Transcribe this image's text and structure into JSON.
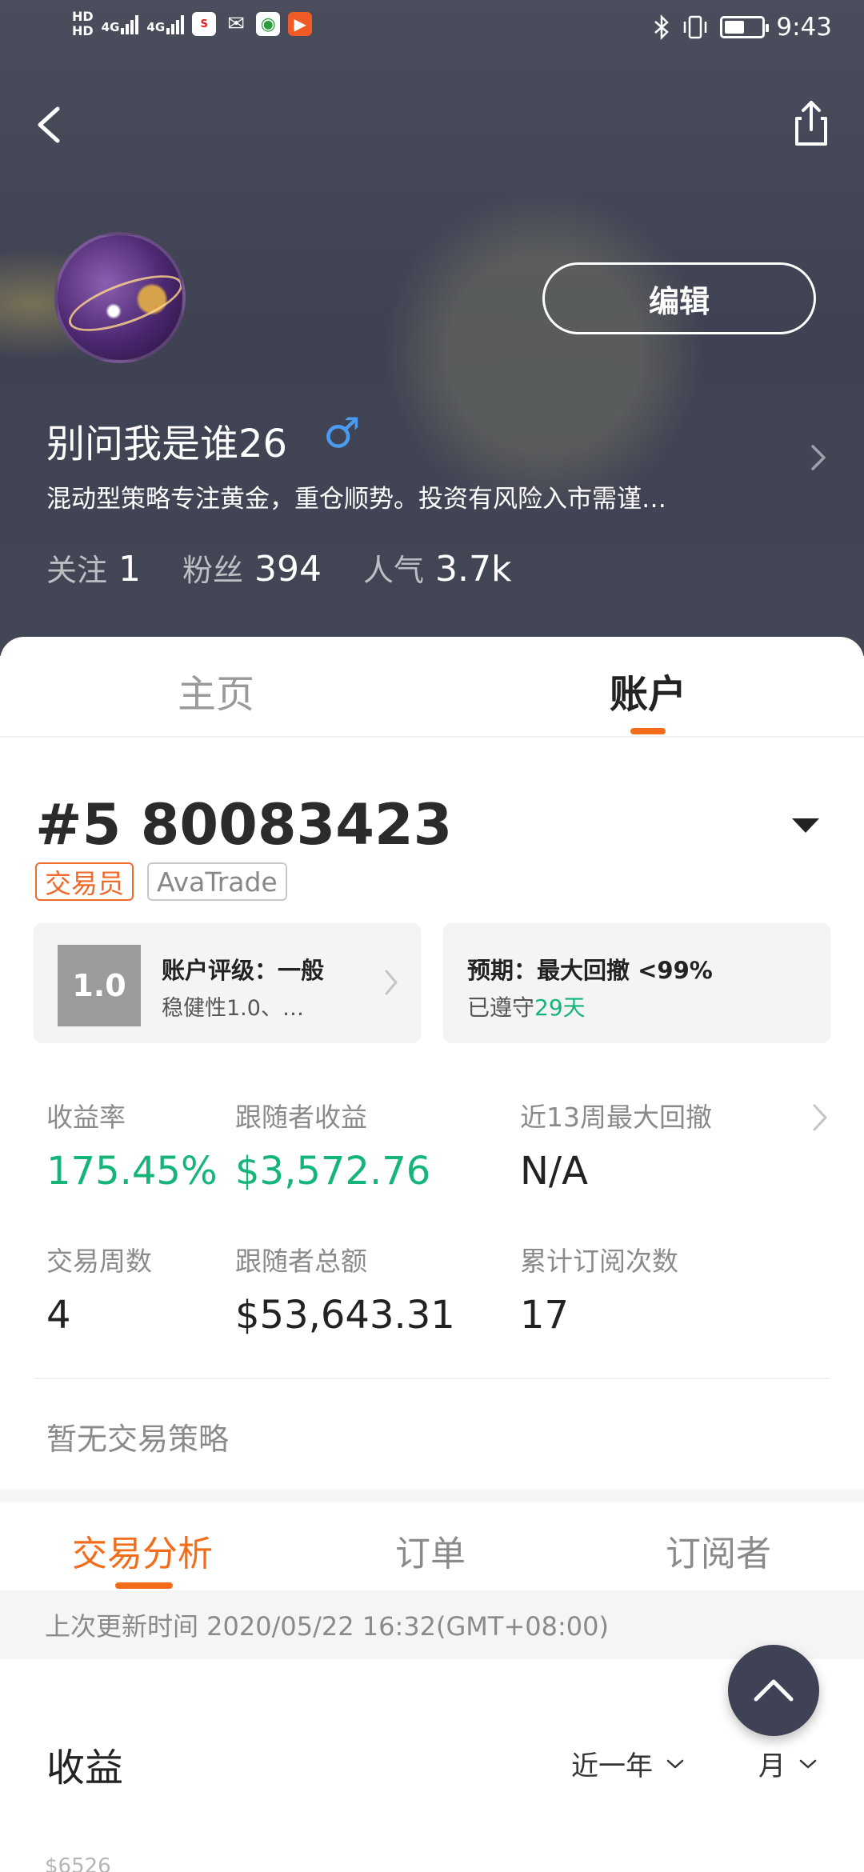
{
  "status_bar": {
    "hd1": "HD",
    "hd2": "HD",
    "net1": "4G",
    "net2": "4G",
    "time": "9:43",
    "battery_level": 0.55
  },
  "profile": {
    "username": "别问我是谁26",
    "gender_symbol": "♂",
    "bio": "混动型策略专注黄金，重仓顺势。投资有风险入市需谨…",
    "edit_label": "编辑",
    "stats": [
      {
        "label": "关注",
        "value": "1"
      },
      {
        "label": "粉丝",
        "value": "394"
      },
      {
        "label": "人气",
        "value": "3.7k"
      }
    ]
  },
  "main_tabs": [
    {
      "label": "主页",
      "active": false
    },
    {
      "label": "账户",
      "active": true
    }
  ],
  "account": {
    "number": "#5 80083423",
    "role_tag": "交易员",
    "broker_tag": "AvaTrade",
    "rating": {
      "badge": "1.0",
      "title": "账户评级：一般",
      "subtitle": "稳健性1.0、…"
    },
    "expectation": {
      "title": "预期：最大回撤 <99%",
      "prefix": "已遵守",
      "days": "29天"
    },
    "metrics": [
      {
        "label": "收益率",
        "value": "175.45%",
        "color": "#15b57a"
      },
      {
        "label": "跟随者收益",
        "value": "$3,572.76",
        "color": "#15b57a"
      },
      {
        "label": "近13周最大回撤",
        "value": "N/A"
      },
      {
        "label": "交易周数",
        "value": "4"
      },
      {
        "label": "跟随者总额",
        "value": "$53,643.31"
      },
      {
        "label": "累计订阅次数",
        "value": "17"
      }
    ],
    "no_strategy": "暂无交易策略"
  },
  "sub_tabs": [
    {
      "label": "交易分析",
      "active": true
    },
    {
      "label": "订单",
      "active": false
    },
    {
      "label": "订阅者",
      "active": false
    }
  ],
  "update_time": "上次更新时间 2020/05/22 16:32(GMT+08:00)",
  "income": {
    "title": "收益",
    "range_filter": "近一年",
    "period_filter": "月",
    "y_axis_top": "$6526"
  },
  "colors": {
    "accent": "#f26c1a",
    "positive": "#15b57a",
    "header_bg": "#434655"
  }
}
